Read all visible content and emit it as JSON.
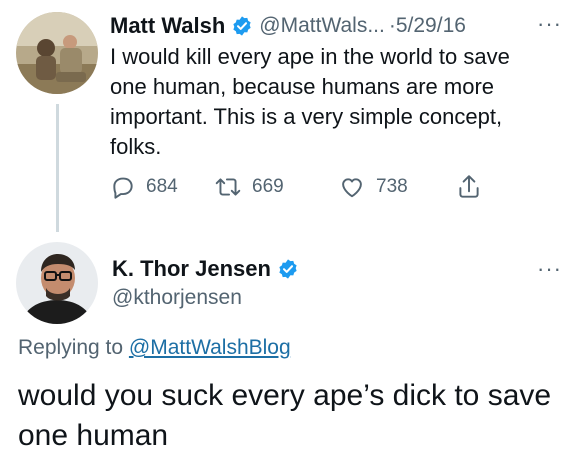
{
  "original_tweet": {
    "author_name": "Matt Walsh",
    "handle": "@MattWals...",
    "date": "5/29/16",
    "separator": "·",
    "more": "···",
    "text": "I would kill every ape in the world to save one human, because humans are more important. This is a very simple concept, folks.",
    "counts": {
      "replies": "684",
      "retweets": "669",
      "likes": "738"
    }
  },
  "reply": {
    "author_name": "K. Thor Jensen",
    "handle": "@kthorjensen",
    "more": "···",
    "replying_prefix": "Replying to",
    "replying_to": "@MattWalshBlog",
    "text": "would you suck every ape’s dick to save one human"
  },
  "colors": {
    "verified": "#1d9bf0",
    "secondary_text": "#536471",
    "link": "#1d6fa5",
    "thread_line": "#cfd9de"
  },
  "icons": {
    "reply": "reply-icon",
    "retweet": "retweet-icon",
    "like": "heart-icon",
    "share": "share-icon",
    "verified": "verified-badge-icon",
    "more": "more-icon"
  }
}
